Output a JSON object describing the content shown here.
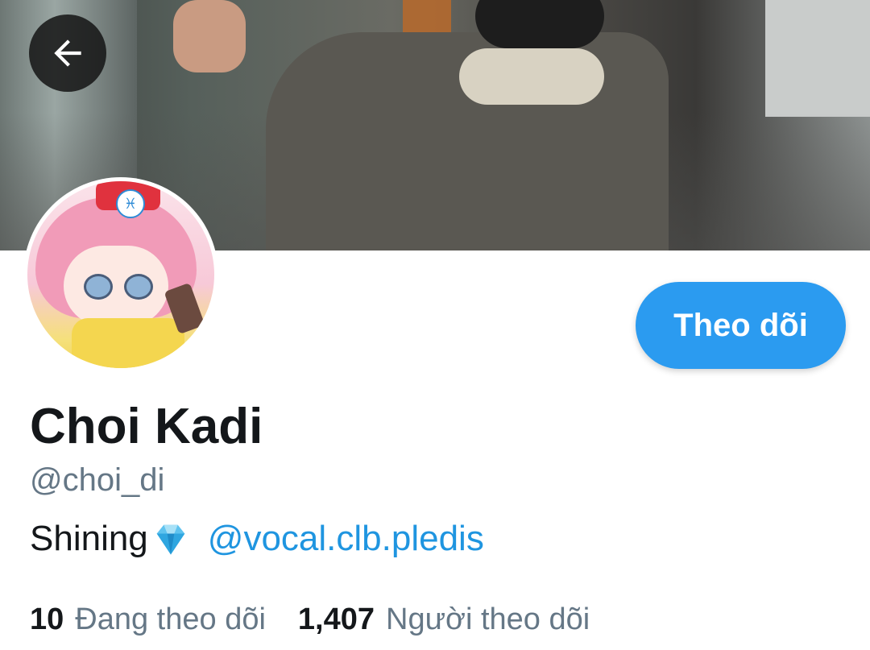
{
  "header": {
    "back_icon": "arrow-left-icon",
    "banner_description": "cover-photo"
  },
  "profile": {
    "follow_button_label": "Theo dõi",
    "display_name": "Choi Kadi",
    "handle": "@choi_di",
    "bio_text": "Shining",
    "bio_emoji_icon": "gem-icon",
    "bio_mention": "@vocal.clb.pledis",
    "avatar_badge_symbol": "♓",
    "following_count": "10",
    "following_label": "Đang theo dõi",
    "followers_count": "1,407",
    "followers_label": "Người theo dõi"
  },
  "colors": {
    "accent": "#2b9bf0",
    "link": "#1f95e0",
    "secondary_text": "#657786",
    "primary_text": "#14171a"
  }
}
